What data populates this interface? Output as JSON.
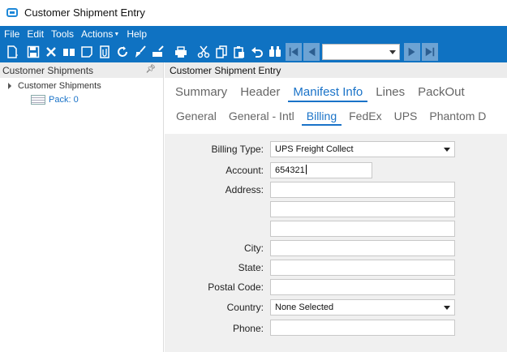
{
  "window": {
    "title": "Customer Shipment Entry"
  },
  "menu": {
    "file": "File",
    "edit": "Edit",
    "tools": "Tools",
    "actions": "Actions",
    "help": "Help"
  },
  "toolbar": {
    "nav_select_value": ""
  },
  "left_panel": {
    "header": "Customer Shipments",
    "tree_root": "Customer Shipments",
    "tree_child": "Pack: 0"
  },
  "right_panel": {
    "header": "Customer Shipment Entry",
    "primary_tabs": [
      "Summary",
      "Header",
      "Manifest Info",
      "Lines",
      "PackOut"
    ],
    "primary_active": "Manifest Info",
    "secondary_tabs": [
      "General",
      "General - Intl",
      "Billing",
      "FedEx",
      "UPS",
      "Phantom D"
    ],
    "secondary_active": "Billing"
  },
  "form": {
    "billing_type_label": "Billing  Type:",
    "billing_type_value": "UPS Freight Collect",
    "account_label": "Account:",
    "account_value": "654321",
    "address_label": "Address:",
    "address1": "",
    "address2": "",
    "address3": "",
    "city_label": "City:",
    "city_value": "",
    "state_label": "State:",
    "state_value": "",
    "postal_label": "Postal Code:",
    "postal_value": "",
    "country_label": "Country:",
    "country_value": "None Selected",
    "phone_label": "Phone:",
    "phone_value": ""
  },
  "colors": {
    "menubar": "#0f72c2",
    "accent": "#1a73c8",
    "form_bg": "#f0f0f0"
  }
}
